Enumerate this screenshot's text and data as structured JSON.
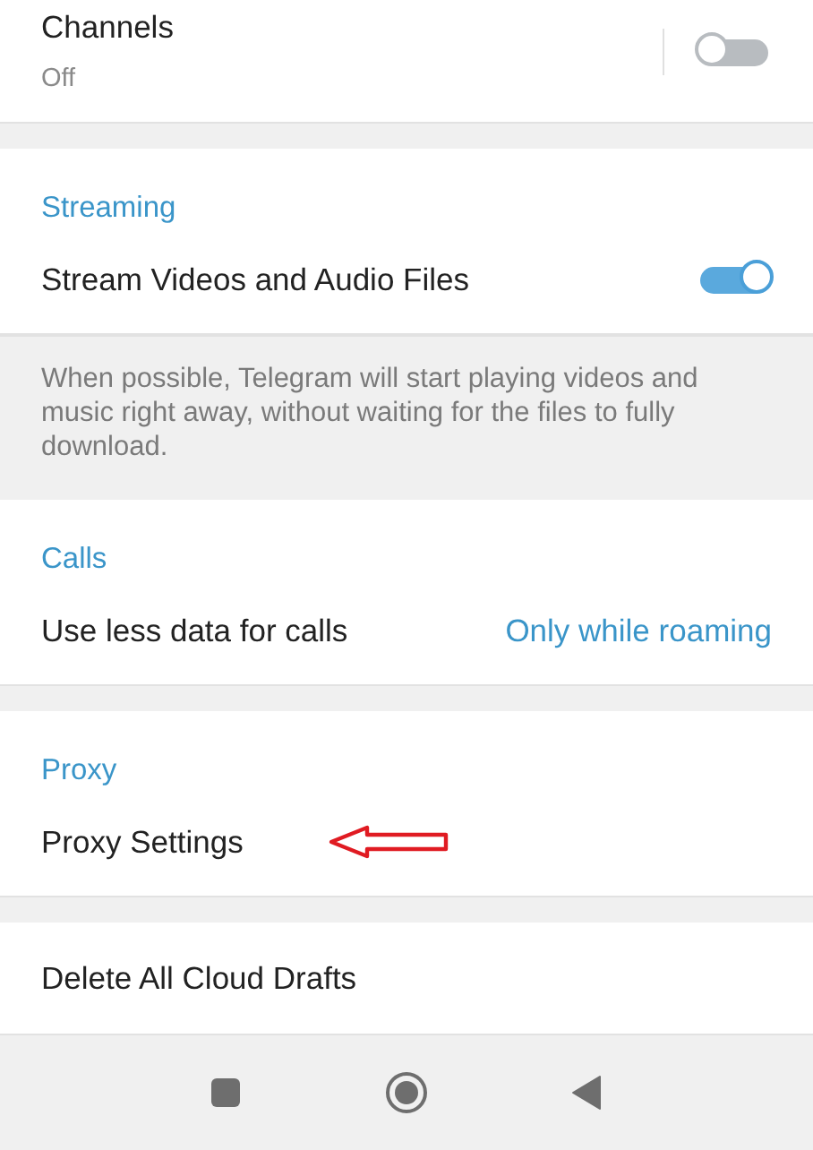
{
  "blocks": [
    {
      "kind": "rows",
      "rows": [
        {
          "kind": "toggle",
          "title": "Channels",
          "subtitle": "Off",
          "divider": true,
          "on": false
        }
      ]
    },
    {
      "kind": "rows",
      "header": "Streaming",
      "rows": [
        {
          "kind": "toggle",
          "title": "Stream Videos and Audio Files",
          "divider": false,
          "on": true
        }
      ]
    },
    {
      "kind": "info",
      "text": "When possible, Telegram will start playing videos and music right away, without waiting for the files to fully download."
    },
    {
      "kind": "rows",
      "header": "Calls",
      "rows": [
        {
          "kind": "value",
          "title": "Use less data for calls",
          "value": "Only while roaming"
        }
      ]
    },
    {
      "kind": "rows",
      "header": "Proxy",
      "rows": [
        {
          "kind": "link",
          "title": "Proxy Settings",
          "annotation_arrow": true
        }
      ]
    },
    {
      "kind": "rows",
      "rows": [
        {
          "kind": "link",
          "title": "Delete All Cloud Drafts",
          "annotation_arrow": false
        }
      ]
    }
  ]
}
